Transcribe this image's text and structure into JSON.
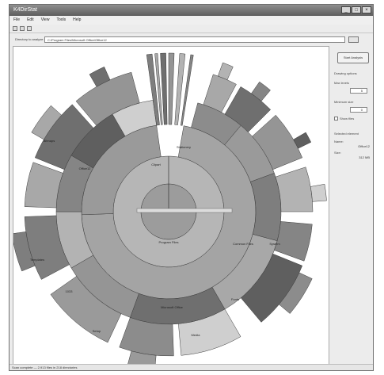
{
  "window": {
    "title": "K4DirStat"
  },
  "menu": [
    "File",
    "Edit",
    "View",
    "Tools",
    "Help"
  ],
  "directory": {
    "label": "Directory to analyze:",
    "value": "C:\\Program Files\\Microsoft Office\\Office12"
  },
  "side": {
    "button_label": "Start Analysis",
    "section_options": "Drawing options",
    "maxlevel_label": "Max levels",
    "maxlevel_value": "5",
    "minsize_label": "Minimum size",
    "minsize_value": "0",
    "check_label": "Show files",
    "section_results": "Selected element",
    "res_name_label": "Name:",
    "res_name_value": "Office12",
    "res_size_label": "Size:",
    "res_size_value": "312 MB"
  },
  "status": "Scan complete — 2,913 files in 218 directories",
  "chart": {
    "labels": {
      "center": "Program Files",
      "left1": "Office12",
      "left2": "Bitmaps",
      "left3": "1033",
      "left4": "Setup",
      "left5": "Templates",
      "bot1": "Microsoft Office",
      "bot2": "Media",
      "bot3": "Fonts",
      "right1": "Common Files",
      "right2": "System",
      "top1": "Stationery",
      "top2": "Clipart"
    }
  }
}
